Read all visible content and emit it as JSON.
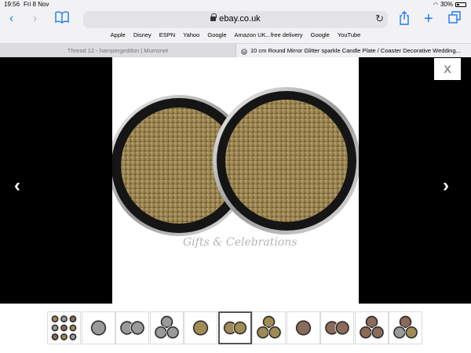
{
  "status_bar": {
    "time": "19:56",
    "date": "Fri 8 Nov",
    "battery": "30%",
    "battery_level": 0.3
  },
  "toolbar": {
    "back_icon": "chevron-left-icon",
    "forward_icon": "chevron-right-icon",
    "bookmarks_icon": "book-icon",
    "share_icon": "share-icon",
    "new_tab_icon": "plus-icon",
    "tabs_icon": "tabs-icon"
  },
  "address_bar": {
    "url": "ebay.co.uk"
  },
  "favourites": [
    "Apple",
    "Disney",
    "ESPN",
    "Yahoo",
    "Google",
    "Amazon UK...free delivery",
    "Google",
    "YouTube"
  ],
  "tabs": [
    {
      "label": "Thread 12 - hampergeddon | Mumsnet",
      "active": false
    },
    {
      "label": "10 cm Round Mirror Glitter sparkle Candle Plate / Coaster Decorative Wedding...",
      "active": true
    }
  ],
  "viewer": {
    "close_label": "X",
    "prev_icon": "‹",
    "next_icon": "›",
    "watermark": "Gifts & Celebrations"
  },
  "thumbnails": [
    {
      "kind": "grid",
      "tone": "mixed",
      "selected": false
    },
    {
      "kind": "single",
      "tone": "silver",
      "selected": false
    },
    {
      "kind": "pair",
      "tone": "silver",
      "selected": false
    },
    {
      "kind": "trio",
      "tone": "silver",
      "selected": false
    },
    {
      "kind": "single",
      "tone": "gold",
      "selected": false
    },
    {
      "kind": "pair",
      "tone": "gold",
      "selected": true
    },
    {
      "kind": "trio",
      "tone": "gold",
      "selected": false
    },
    {
      "kind": "single",
      "tone": "copper",
      "selected": false
    },
    {
      "kind": "pair",
      "tone": "copper",
      "selected": false
    },
    {
      "kind": "trio",
      "tone": "copper",
      "selected": false
    },
    {
      "kind": "trio",
      "tone": "mixed",
      "selected": false
    }
  ],
  "colors": {
    "accent": "#1a7bf2",
    "gold": "#a08a55",
    "silver": "#9a9a9a",
    "copper": "#8a6a58"
  }
}
